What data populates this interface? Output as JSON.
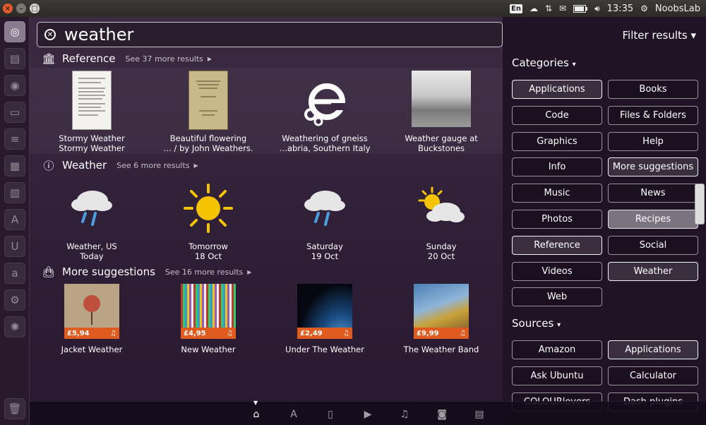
{
  "panel": {
    "window_buttons": {
      "close": "×",
      "minimize": "–",
      "maximize": "□"
    },
    "indicators": {
      "keyboard": "En",
      "clock": "13:35",
      "user": "NoobsLab"
    }
  },
  "search": {
    "query": "weather"
  },
  "reference": {
    "title": "Reference",
    "more": "See 37 more results",
    "items": [
      {
        "line1": "Stormy Weather",
        "line2": "Stormy Weather"
      },
      {
        "line1": "Beautiful flowering",
        "line2": "… / by John Weathers."
      },
      {
        "line1": "Weathering of gneiss",
        "line2": "…abria, Southern Italy"
      },
      {
        "line1": "Weather gauge at",
        "line2": "Buckstones"
      }
    ]
  },
  "weather": {
    "title": "Weather",
    "more": "See 6 more results",
    "items": [
      {
        "line1": "Weather, US",
        "line2": "Today",
        "icon": "rain-cloud-icon"
      },
      {
        "line1": "Tomorrow",
        "line2": "18 Oct",
        "icon": "sun-icon"
      },
      {
        "line1": "Saturday",
        "line2": "19 Oct",
        "icon": "rain-cloud-icon"
      },
      {
        "line1": "Sunday",
        "line2": "20 Oct",
        "icon": "partly-cloudy-icon"
      }
    ]
  },
  "suggestions": {
    "title": "More suggestions",
    "more": "See 16 more results",
    "items": [
      {
        "name": "Jacket Weather",
        "price": "£5,94"
      },
      {
        "name": "New Weather",
        "price": "£4,95"
      },
      {
        "name": "Under The Weather",
        "price": "£2,49"
      },
      {
        "name": "The Weather Band",
        "price": "£9,99"
      }
    ]
  },
  "filter": {
    "title": "Filter results",
    "categories_label": "Categories",
    "categories": [
      {
        "label": "Applications",
        "state": "active"
      },
      {
        "label": "Books",
        "state": ""
      },
      {
        "label": "Code",
        "state": ""
      },
      {
        "label": "Files & Folders",
        "state": ""
      },
      {
        "label": "Graphics",
        "state": ""
      },
      {
        "label": "Help",
        "state": ""
      },
      {
        "label": "Info",
        "state": ""
      },
      {
        "label": "More suggestions",
        "state": "active"
      },
      {
        "label": "Music",
        "state": ""
      },
      {
        "label": "News",
        "state": ""
      },
      {
        "label": "Photos",
        "state": ""
      },
      {
        "label": "Recipes",
        "state": "lit"
      },
      {
        "label": "Reference",
        "state": "active"
      },
      {
        "label": "Social",
        "state": ""
      },
      {
        "label": "Videos",
        "state": ""
      },
      {
        "label": "Weather",
        "state": "active"
      },
      {
        "label": "Web",
        "state": ""
      }
    ],
    "sources_label": "Sources",
    "sources": [
      {
        "label": "Amazon",
        "state": ""
      },
      {
        "label": "Applications",
        "state": "active"
      },
      {
        "label": "Ask Ubuntu",
        "state": ""
      },
      {
        "label": "Calculator",
        "state": ""
      },
      {
        "label": "COLOURlovers",
        "state": ""
      },
      {
        "label": "Dash plugins",
        "state": ""
      }
    ]
  },
  "colors": {
    "accent": "#e05b1f",
    "close": "#e45c2c"
  }
}
